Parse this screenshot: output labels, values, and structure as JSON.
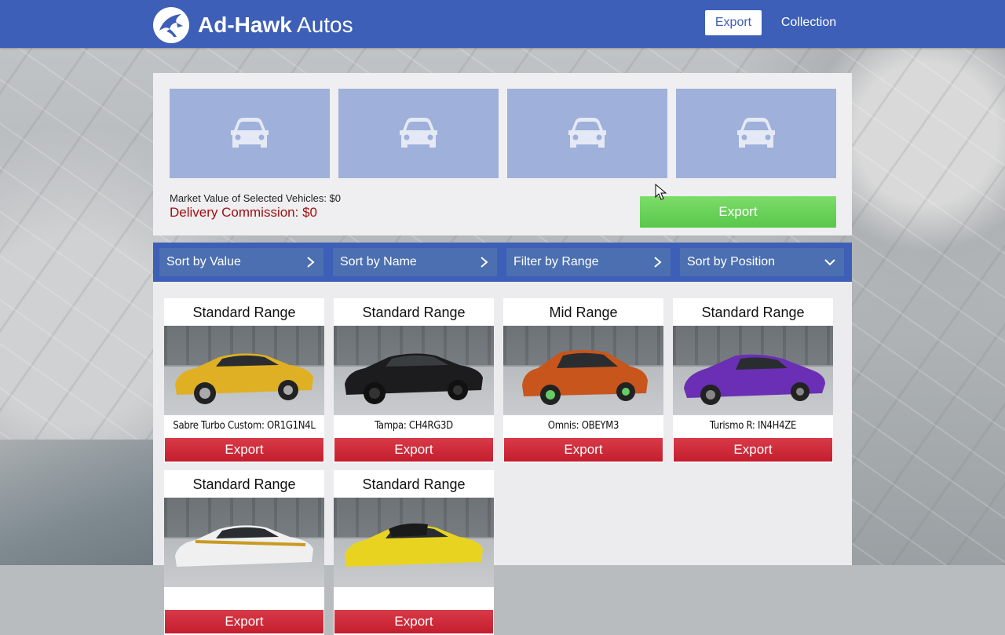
{
  "header": {
    "brand_bold": "Ad-Hawk",
    "brand_light": "Autos",
    "nav": {
      "export_label": "Export",
      "collection_label": "Collection"
    }
  },
  "selection": {
    "slots": [
      "empty",
      "empty",
      "empty",
      "empty"
    ],
    "market_value_text": "Market Value of Selected Vehicles: $0",
    "commission_text": "Delivery Commission: $0",
    "export_label": "Export"
  },
  "filters": [
    {
      "label": "Sort by Value",
      "icon": "chevron-right-icon"
    },
    {
      "label": "Sort by Name",
      "icon": "chevron-right-icon"
    },
    {
      "label": "Filter by Range",
      "icon": "chevron-right-icon"
    },
    {
      "label": "Sort by Position",
      "icon": "chevron-down-icon"
    }
  ],
  "vehicles": [
    {
      "range": "Standard Range",
      "name": "Sabre Turbo Custom: OR1G1N4L",
      "export_label": "Export",
      "color": "#e0b024"
    },
    {
      "range": "Standard Range",
      "name": "Tampa: CH4RG3D",
      "export_label": "Export",
      "color": "#1c1c1e"
    },
    {
      "range": "Mid Range",
      "name": "Omnis: OBEYM3",
      "export_label": "Export",
      "color": "#c8551c"
    },
    {
      "range": "Standard Range",
      "name": "Turismo R: IN4H4ZE",
      "export_label": "Export",
      "color": "#6a2fb4"
    },
    {
      "range": "Standard Range",
      "name": "",
      "export_label": "Export",
      "color": "#f0f0f0"
    },
    {
      "range": "Standard Range",
      "name": "",
      "export_label": "Export",
      "color": "#e8d420"
    }
  ],
  "colors": {
    "header_blue": "#3d5fb7",
    "slot_blue": "#9fb1da",
    "export_green": "#5fcc50",
    "export_red": "#c8202f",
    "commission_red": "#a01010"
  }
}
